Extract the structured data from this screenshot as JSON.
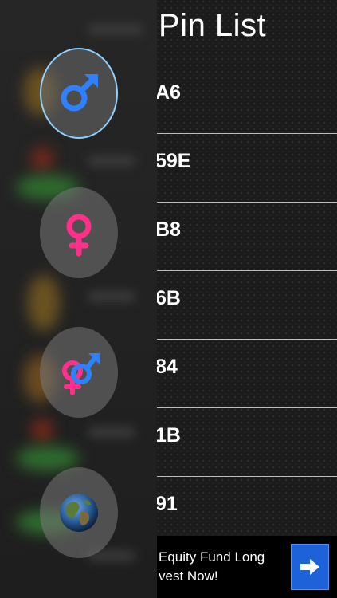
{
  "panel": {
    "title": "Pin List"
  },
  "pins": [
    {
      "label": "A6"
    },
    {
      "label": "59E"
    },
    {
      "label": "B8"
    },
    {
      "label": "6B"
    },
    {
      "label": "84"
    },
    {
      "label": "1B"
    },
    {
      "label": "91"
    }
  ],
  "sidebar": {
    "filters": [
      {
        "icon": "male-symbol-icon",
        "selected": true
      },
      {
        "icon": "female-symbol-icon",
        "selected": false
      },
      {
        "icon": "male-female-symbol-icon",
        "selected": false
      },
      {
        "icon": "globe-icon",
        "selected": false
      }
    ]
  },
  "ad": {
    "line1": "Equity Fund Long",
    "line2": "vest Now!",
    "button_icon": "arrow-right-icon"
  },
  "colors": {
    "male": "#2f80ff",
    "female": "#ff2f8a",
    "selected_ring": "#8fd0ff",
    "ad_button": "#1d62d9"
  }
}
